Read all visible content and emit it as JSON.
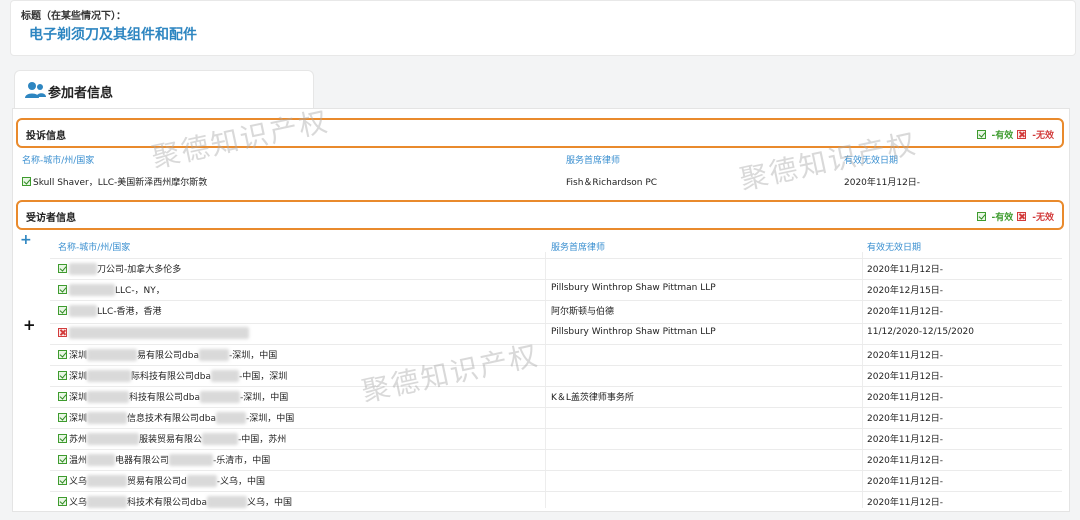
{
  "title_section": {
    "label": "标题（在某些情况下）：",
    "value": "电子剃须刀及其组件和配件"
  },
  "participant_tab": {
    "title": "参加者信息"
  },
  "legend": {
    "valid": "-有效",
    "invalid": "-无效"
  },
  "complainant": {
    "section_title": "投诉信息",
    "headers": {
      "name": "名称-城市/州/国家",
      "counsel": "服务首席律师",
      "dates": "有效无效日期"
    },
    "rows": [
      {
        "status": "valid",
        "name": "Skull Shaver，LLC-美国新泽西州摩尔斯敦",
        "counsel": "Fish＆Richardson PC",
        "dates": "2020年11月12日-"
      }
    ]
  },
  "respondent": {
    "section_title": "受访者信息",
    "headers": {
      "name": "名称-城市/州/国家",
      "counsel": "服务首席律师",
      "dates": "有效无效日期"
    },
    "rows": [
      {
        "status": "valid",
        "name_a": "",
        "name_b": "刀公司-加拿大多伦多",
        "counsel": "",
        "dates": "2020年11月12日-"
      },
      {
        "status": "valid",
        "name_a": "",
        "name_b": "LLC-，NY，",
        "counsel": "Pillsbury Winthrop Shaw Pittman LLP",
        "dates": "2020年12月15日-"
      },
      {
        "status": "valid",
        "name_a": "",
        "name_b": "LLC-香港，香港",
        "counsel": "阿尔斯顿与伯德",
        "dates": "2020年11月12日-"
      },
      {
        "status": "invalid",
        "name_a": "",
        "name_b": "",
        "counsel": "Pillsbury Winthrop Shaw Pittman LLP",
        "dates": "11/12/2020-12/15/2020"
      },
      {
        "status": "valid",
        "name_a": "深圳",
        "name_b": "易有限公司dba",
        "name_c": "-深圳，中国",
        "counsel": "",
        "dates": "2020年11月12日-"
      },
      {
        "status": "valid",
        "name_a": "深圳",
        "name_b": "际科技有限公司dba",
        "name_c": "-中国，深圳",
        "counsel": "",
        "dates": "2020年11月12日-"
      },
      {
        "status": "valid",
        "name_a": "深圳",
        "name_b": "科技有限公司dba",
        "name_c": "-深圳，中国",
        "counsel": "K＆L盖茨律师事务所",
        "dates": "2020年11月12日-"
      },
      {
        "status": "valid",
        "name_a": "深圳",
        "name_b": "信息技术有限公司dba",
        "name_c": "-深圳，中国",
        "counsel": "",
        "dates": "2020年11月12日-"
      },
      {
        "status": "valid",
        "name_a": "苏州",
        "name_b": "服装贸易有限公",
        "name_c": "-中国，苏州",
        "counsel": "",
        "dates": "2020年11月12日-"
      },
      {
        "status": "valid",
        "name_a": "温州",
        "name_b": "电器有限公司",
        "name_c": "-乐清市，中国",
        "counsel": "",
        "dates": "2020年11月12日-"
      },
      {
        "status": "valid",
        "name_a": "义乌",
        "name_b": "贸易有限公司d",
        "name_c": "-义乌，中国",
        "counsel": "",
        "dates": "2020年11月12日-"
      },
      {
        "status": "valid",
        "name_a": "义乌",
        "name_b": "科技术有限公司dba",
        "name_c": "义乌，中国",
        "counsel": "",
        "dates": "2020年11月12日-"
      }
    ]
  },
  "watermark": "聚德知识产权",
  "colors": {
    "accent_blue": "#2e86c1",
    "section_border": "#e98a2c",
    "valid_green": "#3e9b2e",
    "invalid_red": "#d23b3b"
  }
}
